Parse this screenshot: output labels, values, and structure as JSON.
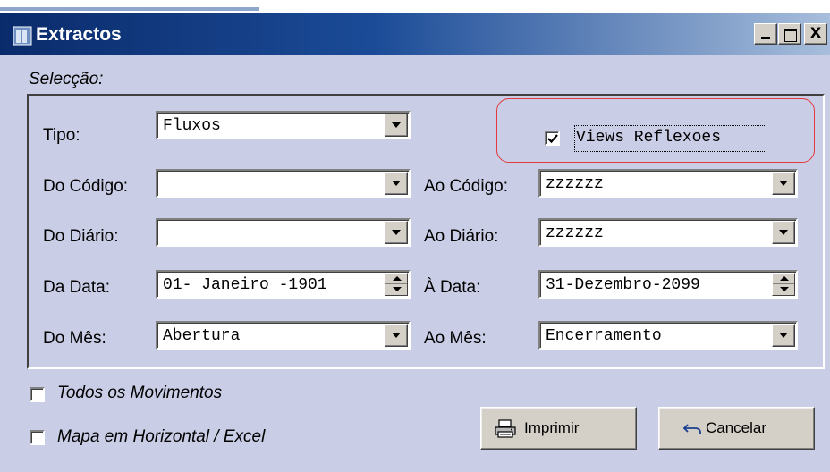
{
  "window": {
    "title": "Extractos",
    "controls": {
      "minimize": "_",
      "maximize": "□",
      "close": "X"
    }
  },
  "selection": {
    "section_label": "Selecção:",
    "tipo": {
      "label": "Tipo:",
      "value": "Fluxos"
    },
    "views_reflexoes": {
      "label": "Views Reflexoes",
      "checked": true
    },
    "do_codigo": {
      "label": "Do Código:",
      "value": ""
    },
    "ao_codigo": {
      "label": "Ao Código:",
      "value": "zzzzzz"
    },
    "do_diario": {
      "label": "Do Diário:",
      "value": ""
    },
    "ao_diario": {
      "label": "Ao Diário:",
      "value": "zzzzzz"
    },
    "da_data": {
      "label": "Da Data:",
      "value": "01- Janeiro -1901"
    },
    "a_data": {
      "label": "À Data:",
      "value": "31-Dezembro-2099"
    },
    "do_mes": {
      "label": "Do Mês:",
      "value": "Abertura"
    },
    "ao_mes": {
      "label": "Ao Mês:",
      "value": "Encerramento"
    }
  },
  "options": {
    "todos_movimentos": {
      "label": "Todos os Movimentos",
      "checked": false
    },
    "mapa_horizontal": {
      "label": "Mapa em Horizontal / Excel",
      "checked": false
    }
  },
  "buttons": {
    "print": {
      "label": "Imprimir",
      "icon": "printer-icon"
    },
    "cancel": {
      "label": "Cancelar",
      "icon": "undo-arrow-icon"
    }
  },
  "colors": {
    "title_bar_start": "#0a2b6b",
    "title_bar_end": "#a8bedc",
    "window_background": "#c9cde5",
    "highlight_outline": "#e23a3a"
  }
}
